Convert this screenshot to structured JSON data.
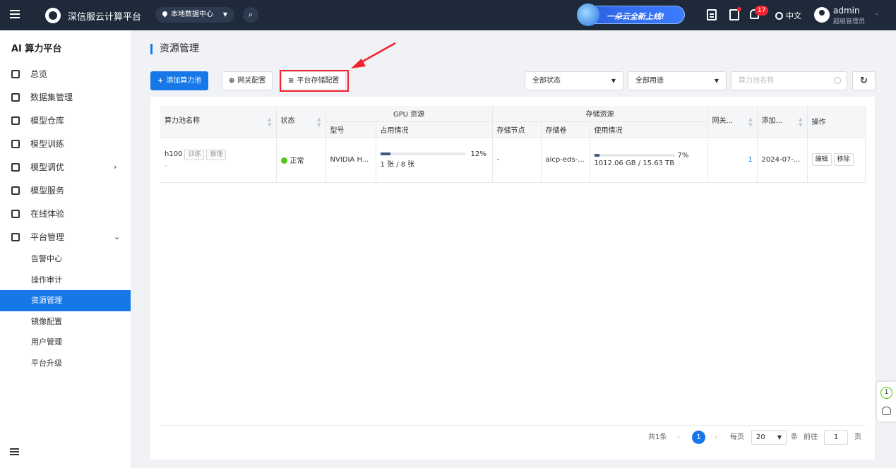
{
  "topbar": {
    "brand": "深信服云计算平台",
    "datacenter": "本地数据中心",
    "promo": "一朵云全新上线!",
    "notification_count": "17",
    "language": "中文",
    "user_name": "admin",
    "user_role": "超级管理员"
  },
  "sidebar": {
    "title": "AI 算力平台",
    "items": [
      {
        "label": "总览",
        "icon": "monitor-icon"
      },
      {
        "label": "数据集管理",
        "icon": "bar-chart-icon"
      },
      {
        "label": "模型仓库",
        "icon": "warehouse-icon"
      },
      {
        "label": "模型训练",
        "icon": "training-icon"
      },
      {
        "label": "模型调优",
        "icon": "tuning-icon"
      },
      {
        "label": "模型服务",
        "icon": "service-icon"
      },
      {
        "label": "在线体验",
        "icon": "chat-icon"
      },
      {
        "label": "平台管理",
        "icon": "platform-icon"
      }
    ],
    "sub_items": [
      "告警中心",
      "操作审计",
      "资源管理",
      "镜像配置",
      "用户管理",
      "平台升级"
    ],
    "active_sub": "资源管理"
  },
  "page": {
    "title": "资源管理"
  },
  "toolbar": {
    "add_pool": "添加算力池",
    "gateway_config": "网关配置",
    "storage_config": "平台存储配置",
    "status_filter": "全部状态",
    "usage_filter": "全部用途",
    "search_placeholder": "算力池名称"
  },
  "table": {
    "headers": {
      "pool_name": "算力池名称",
      "status": "状态",
      "gpu_group": "GPU 资源",
      "model": "型号",
      "gpu_usage": "占用情况",
      "storage_group": "存储资源",
      "storage_node": "存储节点",
      "storage_volume": "存储卷",
      "storage_usage": "使用情况",
      "gateway": "网关...",
      "added": "添加...",
      "actions": "操作"
    },
    "rows": [
      {
        "name": "h100",
        "tags": [
          "训练",
          "推理"
        ],
        "sub": "-",
        "status": "正常",
        "model": "NVIDIA H...",
        "gpu_percent_text": "12%",
        "gpu_percent": 0.12,
        "gpu_count": "1 张 / 8 张",
        "storage_node": "-",
        "storage_volume": "aicp-eds-...",
        "storage_percent_text": "7%",
        "storage_percent": 0.07,
        "storage_used": "1012.06 GB / 15.63 TB",
        "gateway": "1",
        "added": "2024-07-...",
        "edit": "编辑",
        "remove": "移除"
      }
    ]
  },
  "pagination": {
    "total": "共1条",
    "current_page": "1",
    "per_page_label": "每页",
    "per_page": "20",
    "unit": "条",
    "goto_label": "前往",
    "goto_value": "1",
    "page_unit": "页"
  },
  "float_panel": {
    "counter": "1"
  },
  "colors": {
    "topbar_bg": "#1e2a3a",
    "primary": "#1677e8",
    "highlight": "#f5222d",
    "success": "#52c41a"
  }
}
